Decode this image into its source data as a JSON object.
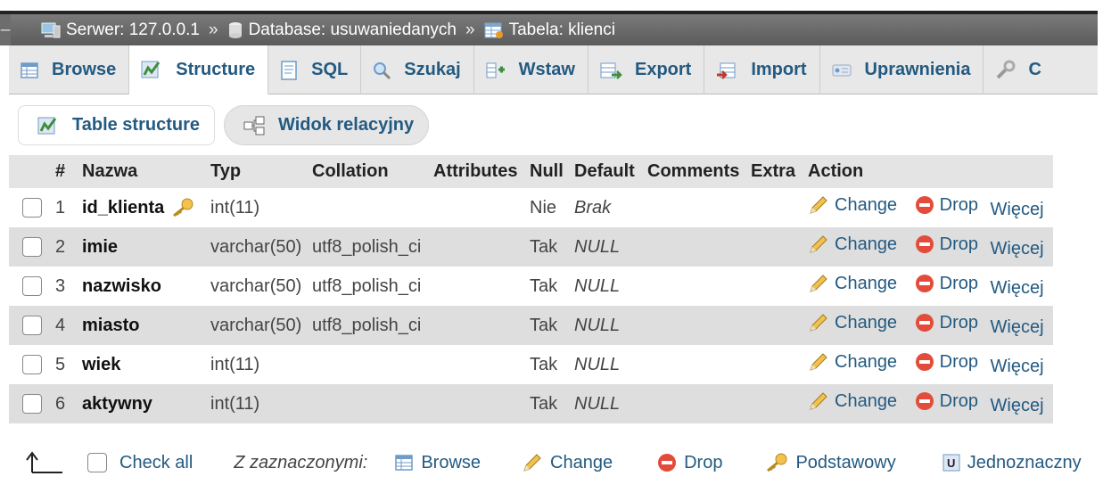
{
  "breadcrumb": {
    "server": "Serwer: 127.0.0.1",
    "database": "Database: usuwaniedanych",
    "table": "Tabela: klienci",
    "separator": "»"
  },
  "tabs": [
    {
      "label": "Browse",
      "icon": "browse-icon"
    },
    {
      "label": "Structure",
      "icon": "structure-icon"
    },
    {
      "label": "SQL",
      "icon": "sql-icon"
    },
    {
      "label": "Szukaj",
      "icon": "search-icon"
    },
    {
      "label": "Wstaw",
      "icon": "insert-icon"
    },
    {
      "label": "Export",
      "icon": "export-icon"
    },
    {
      "label": "Import",
      "icon": "import-icon"
    },
    {
      "label": "Uprawnienia",
      "icon": "privileges-icon"
    },
    {
      "label": "C",
      "icon": "operations-icon"
    }
  ],
  "subtabs": {
    "table_structure": "Table structure",
    "relation_view": "Widok relacyjny"
  },
  "columns": [
    "#",
    "Nazwa",
    "Typ",
    "Collation",
    "Attributes",
    "Null",
    "Default",
    "Comments",
    "Extra",
    "Action"
  ],
  "rows": [
    {
      "num": "1",
      "name": "id_klienta",
      "type": "int(11)",
      "collation": "",
      "null": "Nie",
      "default": "Brak",
      "primary": true
    },
    {
      "num": "2",
      "name": "imie",
      "type": "varchar(50)",
      "collation": "utf8_polish_ci",
      "null": "Tak",
      "default": "NULL"
    },
    {
      "num": "3",
      "name": "nazwisko",
      "type": "varchar(50)",
      "collation": "utf8_polish_ci",
      "null": "Tak",
      "default": "NULL"
    },
    {
      "num": "4",
      "name": "miasto",
      "type": "varchar(50)",
      "collation": "utf8_polish_ci",
      "null": "Tak",
      "default": "NULL"
    },
    {
      "num": "5",
      "name": "wiek",
      "type": "int(11)",
      "collation": "",
      "null": "Tak",
      "default": "NULL"
    },
    {
      "num": "6",
      "name": "aktywny",
      "type": "int(11)",
      "collation": "",
      "null": "Tak",
      "default": "NULL"
    }
  ],
  "actions": {
    "change": "Change",
    "drop": "Drop",
    "more": "Więcej"
  },
  "footer": {
    "check_all": "Check all",
    "with_selected": "Z zaznaczonymi:",
    "browse": "Browse",
    "change": "Change",
    "drop": "Drop",
    "primary": "Podstawowy",
    "unique": "Jednoznaczny"
  },
  "colors": {
    "link": "#235a81",
    "header_bg": "#e4e4e4",
    "row_alt": "#dedede",
    "crumb_bg": "#6a6a6a"
  }
}
